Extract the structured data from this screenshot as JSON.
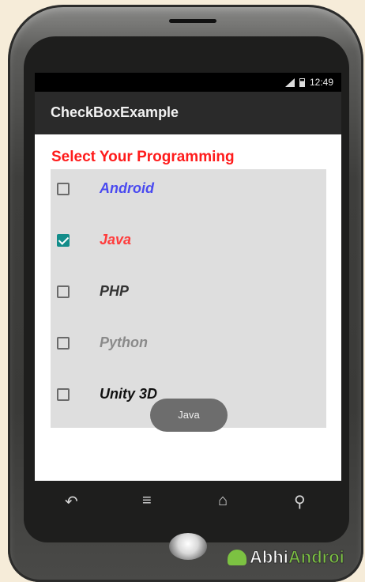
{
  "status_bar": {
    "time": "12:49"
  },
  "action_bar": {
    "title": "CheckBoxExample"
  },
  "heading": "Select Your Programming",
  "checkboxes": [
    {
      "label": "Android",
      "checked": false,
      "color": "#4a4af0"
    },
    {
      "label": "Java",
      "checked": true,
      "color": "#ff3b3b"
    },
    {
      "label": "PHP",
      "checked": false,
      "color": "#333333"
    },
    {
      "label": "Python",
      "checked": false,
      "color": "#8a8a8a"
    },
    {
      "label": "Unity 3D",
      "checked": false,
      "color": "#111111"
    }
  ],
  "toast": {
    "text": "Java"
  },
  "nav": {
    "back_icon": "back-icon",
    "recents_icon": "recents-icon",
    "home_icon": "home-icon",
    "search_icon": "search-icon"
  },
  "watermark": {
    "text_a": "Abhi",
    "text_b": "Androi"
  },
  "colors": {
    "accent": "#138d8a",
    "heading": "#ff1b1b",
    "action_bar": "#2a2a2a"
  }
}
